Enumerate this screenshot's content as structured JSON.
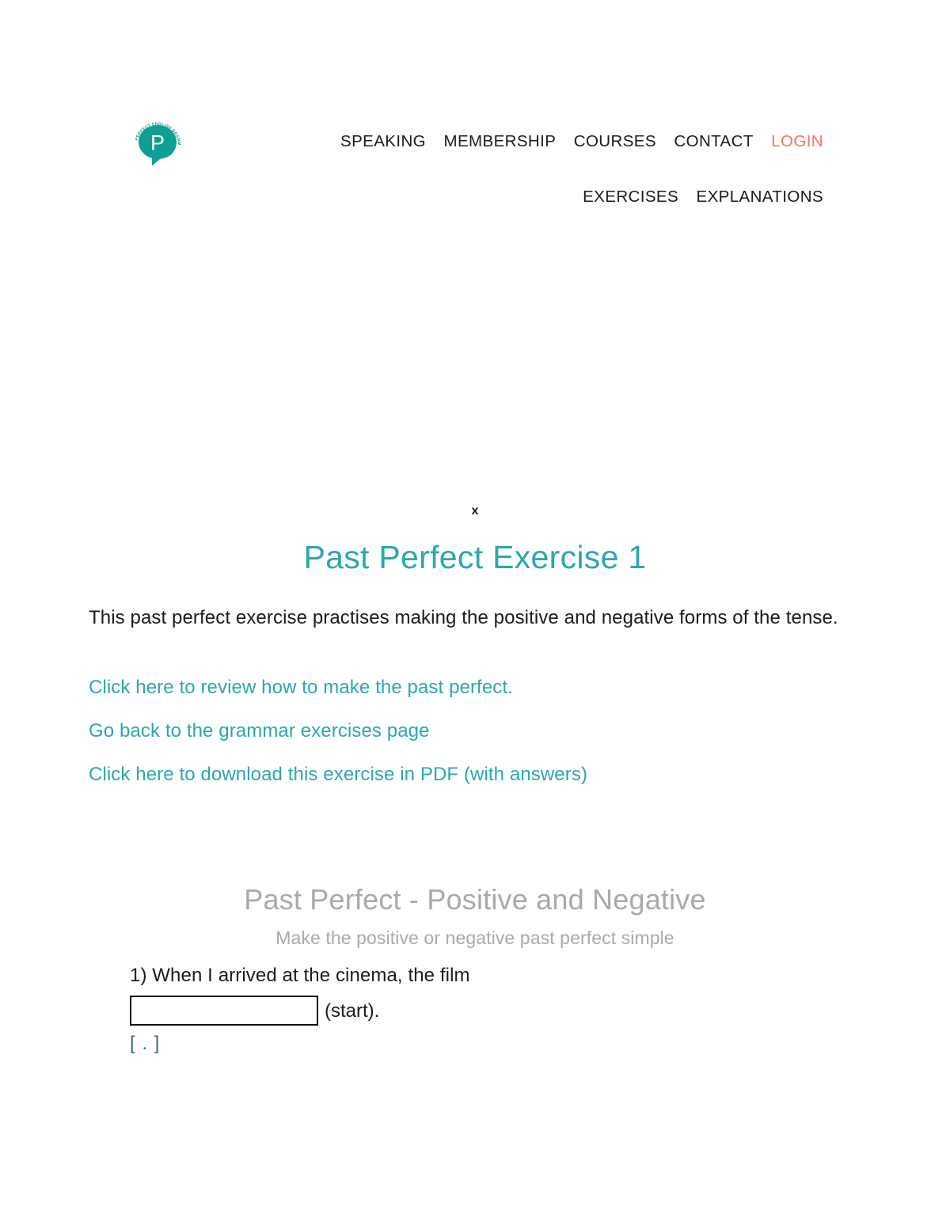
{
  "header": {
    "logo": {
      "icon": "speech-bubble-logo-icon",
      "letter": "P",
      "curved_text": "PERFECT ENGLISH GRAMMAR",
      "color": "#0f9e94"
    },
    "nav_primary": [
      {
        "label": "SPEAKING",
        "accent": false
      },
      {
        "label": "MEMBERSHIP",
        "accent": false
      },
      {
        "label": "COURSES",
        "accent": false
      },
      {
        "label": "CONTACT",
        "accent": false
      },
      {
        "label": "LOGIN",
        "accent": true
      }
    ],
    "nav_secondary": [
      {
        "label": "EXERCISES",
        "accent": false
      },
      {
        "label": "EXPLANATIONS",
        "accent": false
      }
    ],
    "accent_color": "#f9715f",
    "nav_text_color": "#1b1b1b"
  },
  "ad": {
    "close_label": "x"
  },
  "main": {
    "title": "Past Perfect Exercise 1",
    "title_color": "#2ba8ab",
    "intro": "This past perfect exercise practises making the positive and negative forms of the tense.",
    "links": [
      {
        "label": "Click here to review how to make the past perfect."
      },
      {
        "label": "Go back to the grammar exercises page"
      },
      {
        "label": "Click here to download this exercise in PDF (with answers)"
      }
    ],
    "link_color": "#2ba8ab"
  },
  "exercise": {
    "title": "Past Perfect - Positive and Negative",
    "subtitle": "Make the positive or negative past perfect simple",
    "heading_color": "#a9a9a9",
    "questions": [
      {
        "number": "1)",
        "prompt": "1) When I arrived at the cinema, the film",
        "input_value": "",
        "input_placeholder": "",
        "suffix": "(start).",
        "hint_marker": "[ . ]"
      }
    ]
  }
}
